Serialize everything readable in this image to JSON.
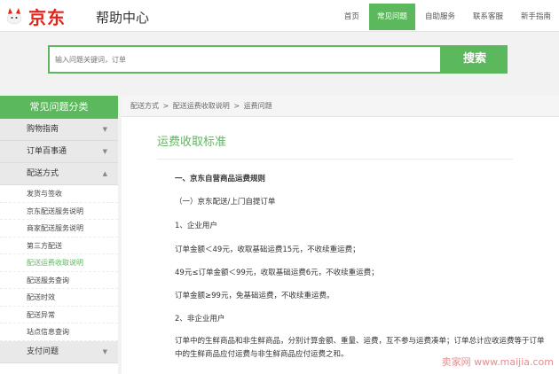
{
  "header": {
    "logo_text": "京东",
    "title": "帮助中心",
    "nav": [
      {
        "label": "首页",
        "active": false
      },
      {
        "label": "常见问题",
        "active": true
      },
      {
        "label": "自助服务",
        "active": false
      },
      {
        "label": "联系客服",
        "active": false
      },
      {
        "label": "新手指南",
        "active": false
      }
    ]
  },
  "search": {
    "placeholder": "输入问题关键词，订单",
    "button_label": "搜索"
  },
  "sidebar": {
    "heading": "常见问题分类",
    "items": [
      {
        "type": "cat",
        "label": "购物指南",
        "arrow": "▼"
      },
      {
        "type": "cat",
        "label": "订单百事通",
        "arrow": "▼"
      },
      {
        "type": "cat",
        "label": "配送方式",
        "arrow": "▲"
      },
      {
        "type": "sub",
        "label": "发货与签收"
      },
      {
        "type": "sub",
        "label": "京东配送服务说明"
      },
      {
        "type": "sub",
        "label": "商家配送服务说明"
      },
      {
        "type": "sub",
        "label": "第三方配送"
      },
      {
        "type": "sub",
        "label": "配送运费收取说明",
        "active": true
      },
      {
        "type": "sub",
        "label": "配送服务查询"
      },
      {
        "type": "sub",
        "label": "配送时效"
      },
      {
        "type": "sub",
        "label": "配送异常"
      },
      {
        "type": "sub",
        "label": "站点信息查询"
      },
      {
        "type": "cat",
        "label": "支付问题",
        "arrow": "▼"
      }
    ]
  },
  "breadcrumb": [
    "配送方式",
    ">",
    "配送运费收取说明",
    ">",
    "运费问题"
  ],
  "article": {
    "title": "运费收取标准",
    "paragraphs": [
      {
        "text": "一、京东自营商品运费规则",
        "bold": true
      },
      {
        "text": "（一）京东配送/上门自提订单",
        "bold": false
      },
      {
        "text": "1、企业用户",
        "bold": false
      },
      {
        "text": "订单金额＜49元，收取基础运费15元，不收续重运费；",
        "bold": false
      },
      {
        "text": "49元≤订单金额＜99元，收取基础运费6元，不收续重运费；",
        "bold": false
      },
      {
        "text": "订单金额≥99元，免基础运费，不收续重运费。",
        "bold": false
      },
      {
        "text": "2、非企业用户",
        "bold": false
      },
      {
        "text": "订单中的生鲜商品和非生鲜商品，分别计算金额、重量、运费，互不参与运费凑单；订单总计应收运费等于订单中的生鲜商品应付运费与非生鲜商品应付运费之和。",
        "bold": false
      }
    ]
  },
  "watermark": "卖家网 www.maijia.com",
  "colors": {
    "accent": "#5cb85c",
    "brand": "#e1251b"
  }
}
